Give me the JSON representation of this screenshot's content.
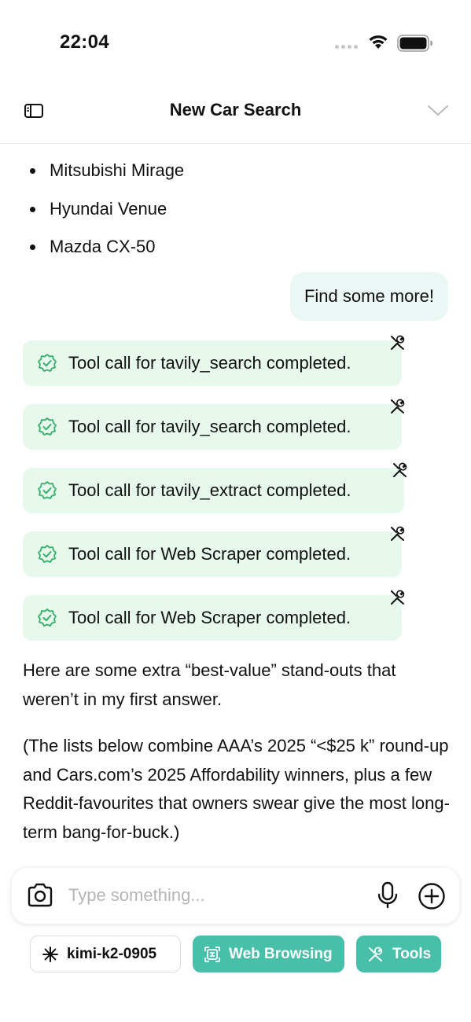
{
  "status_bar": {
    "time": "22:04"
  },
  "header": {
    "title": "New Car Search"
  },
  "chat": {
    "bullets": [
      "Mitsubishi Mirage",
      "Hyundai Venue",
      "Mazda CX-50"
    ],
    "user_message": "Find some more!",
    "tool_calls": [
      "Tool call for tavily_search completed.",
      "Tool call for tavily_search completed.",
      "Tool call for tavily_extract completed.",
      "Tool call for Web Scraper completed.",
      "Tool call for Web Scraper completed."
    ],
    "assistant_paragraphs": [
      "Here are some extra “best-value” stand-outs that weren’t in my first answer.",
      "(The lists below combine AAA’s 2025 “<$25 k” round-up and Cars.com’s 2025 Affordability winners, plus a few Reddit-favourites that owners swear give the most long-term bang-for-buck.)"
    ]
  },
  "input": {
    "placeholder": "Type something..."
  },
  "chips": {
    "model": "kimi-k2-0905",
    "web": "Web Browsing",
    "tools": "Tools"
  },
  "colors": {
    "accent": "#48bfa8",
    "tool_card_bg": "#e7f8ec",
    "tool_check": "#35b06a",
    "user_bubble_bg": "#eaf7f4"
  }
}
